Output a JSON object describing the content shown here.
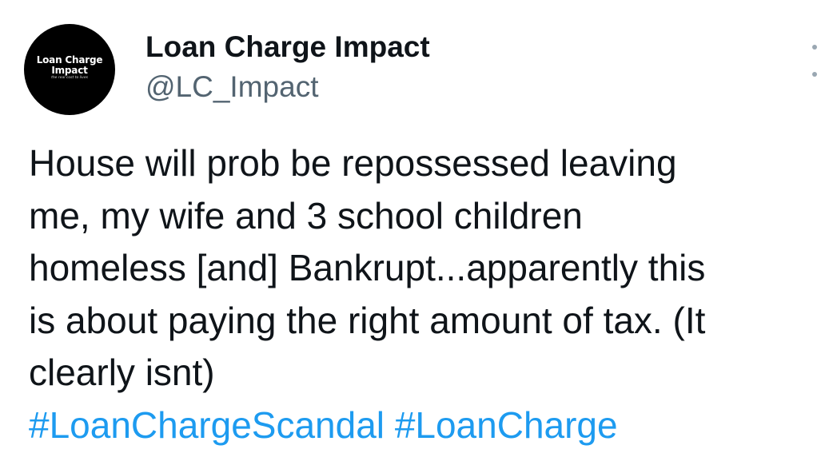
{
  "author": {
    "avatar": {
      "line1": "Loan Charge",
      "line2": "Impact",
      "tagline": "the real cost to lives"
    },
    "display_name": "Loan Charge Impact",
    "handle": "@LC_Impact"
  },
  "more_icon": "more-vertical-icon",
  "tweet": {
    "lines": [
      "House will prob be repossessed leaving",
      "me, my wife and 3 school children",
      "homeless [and] Bankrupt...apparently this",
      "is about paying the right amount of tax. (It",
      "clearly isnt)"
    ],
    "hashtags": [
      "#LoanChargeScandal",
      "#LoanCharge"
    ]
  },
  "colors": {
    "hashtag": "#1d9bf0",
    "handle": "#536471",
    "text": "#0f1419"
  }
}
